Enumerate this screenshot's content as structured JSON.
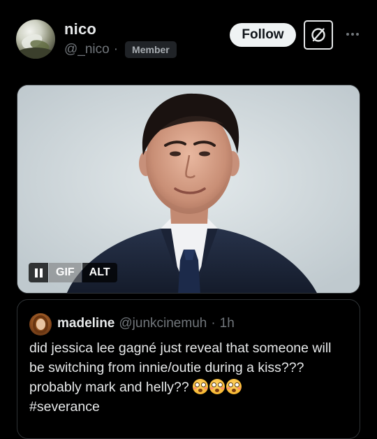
{
  "post": {
    "author": {
      "display_name": "nico",
      "handle": "@_nico",
      "separator": "·",
      "badge": "Member"
    },
    "actions": {
      "follow_label": "Follow",
      "grok_icon": "grok-icon",
      "more_icon": "more-icon"
    },
    "media": {
      "type": "gif",
      "pause_icon": "pause-icon",
      "gif_label": "GIF",
      "alt_label": "ALT"
    }
  },
  "quote": {
    "display_name": "madeline",
    "handle": "@junkcinemuh",
    "separator": "·",
    "time": "1h",
    "text": "did jessica lee gagné just reveal that someone will be switching from innie/outie during a kiss??? probably mark and helly?? ",
    "emojis": [
      "flushed-face",
      "flushed-face",
      "flushed-face"
    ],
    "hashtag": "#severance"
  }
}
